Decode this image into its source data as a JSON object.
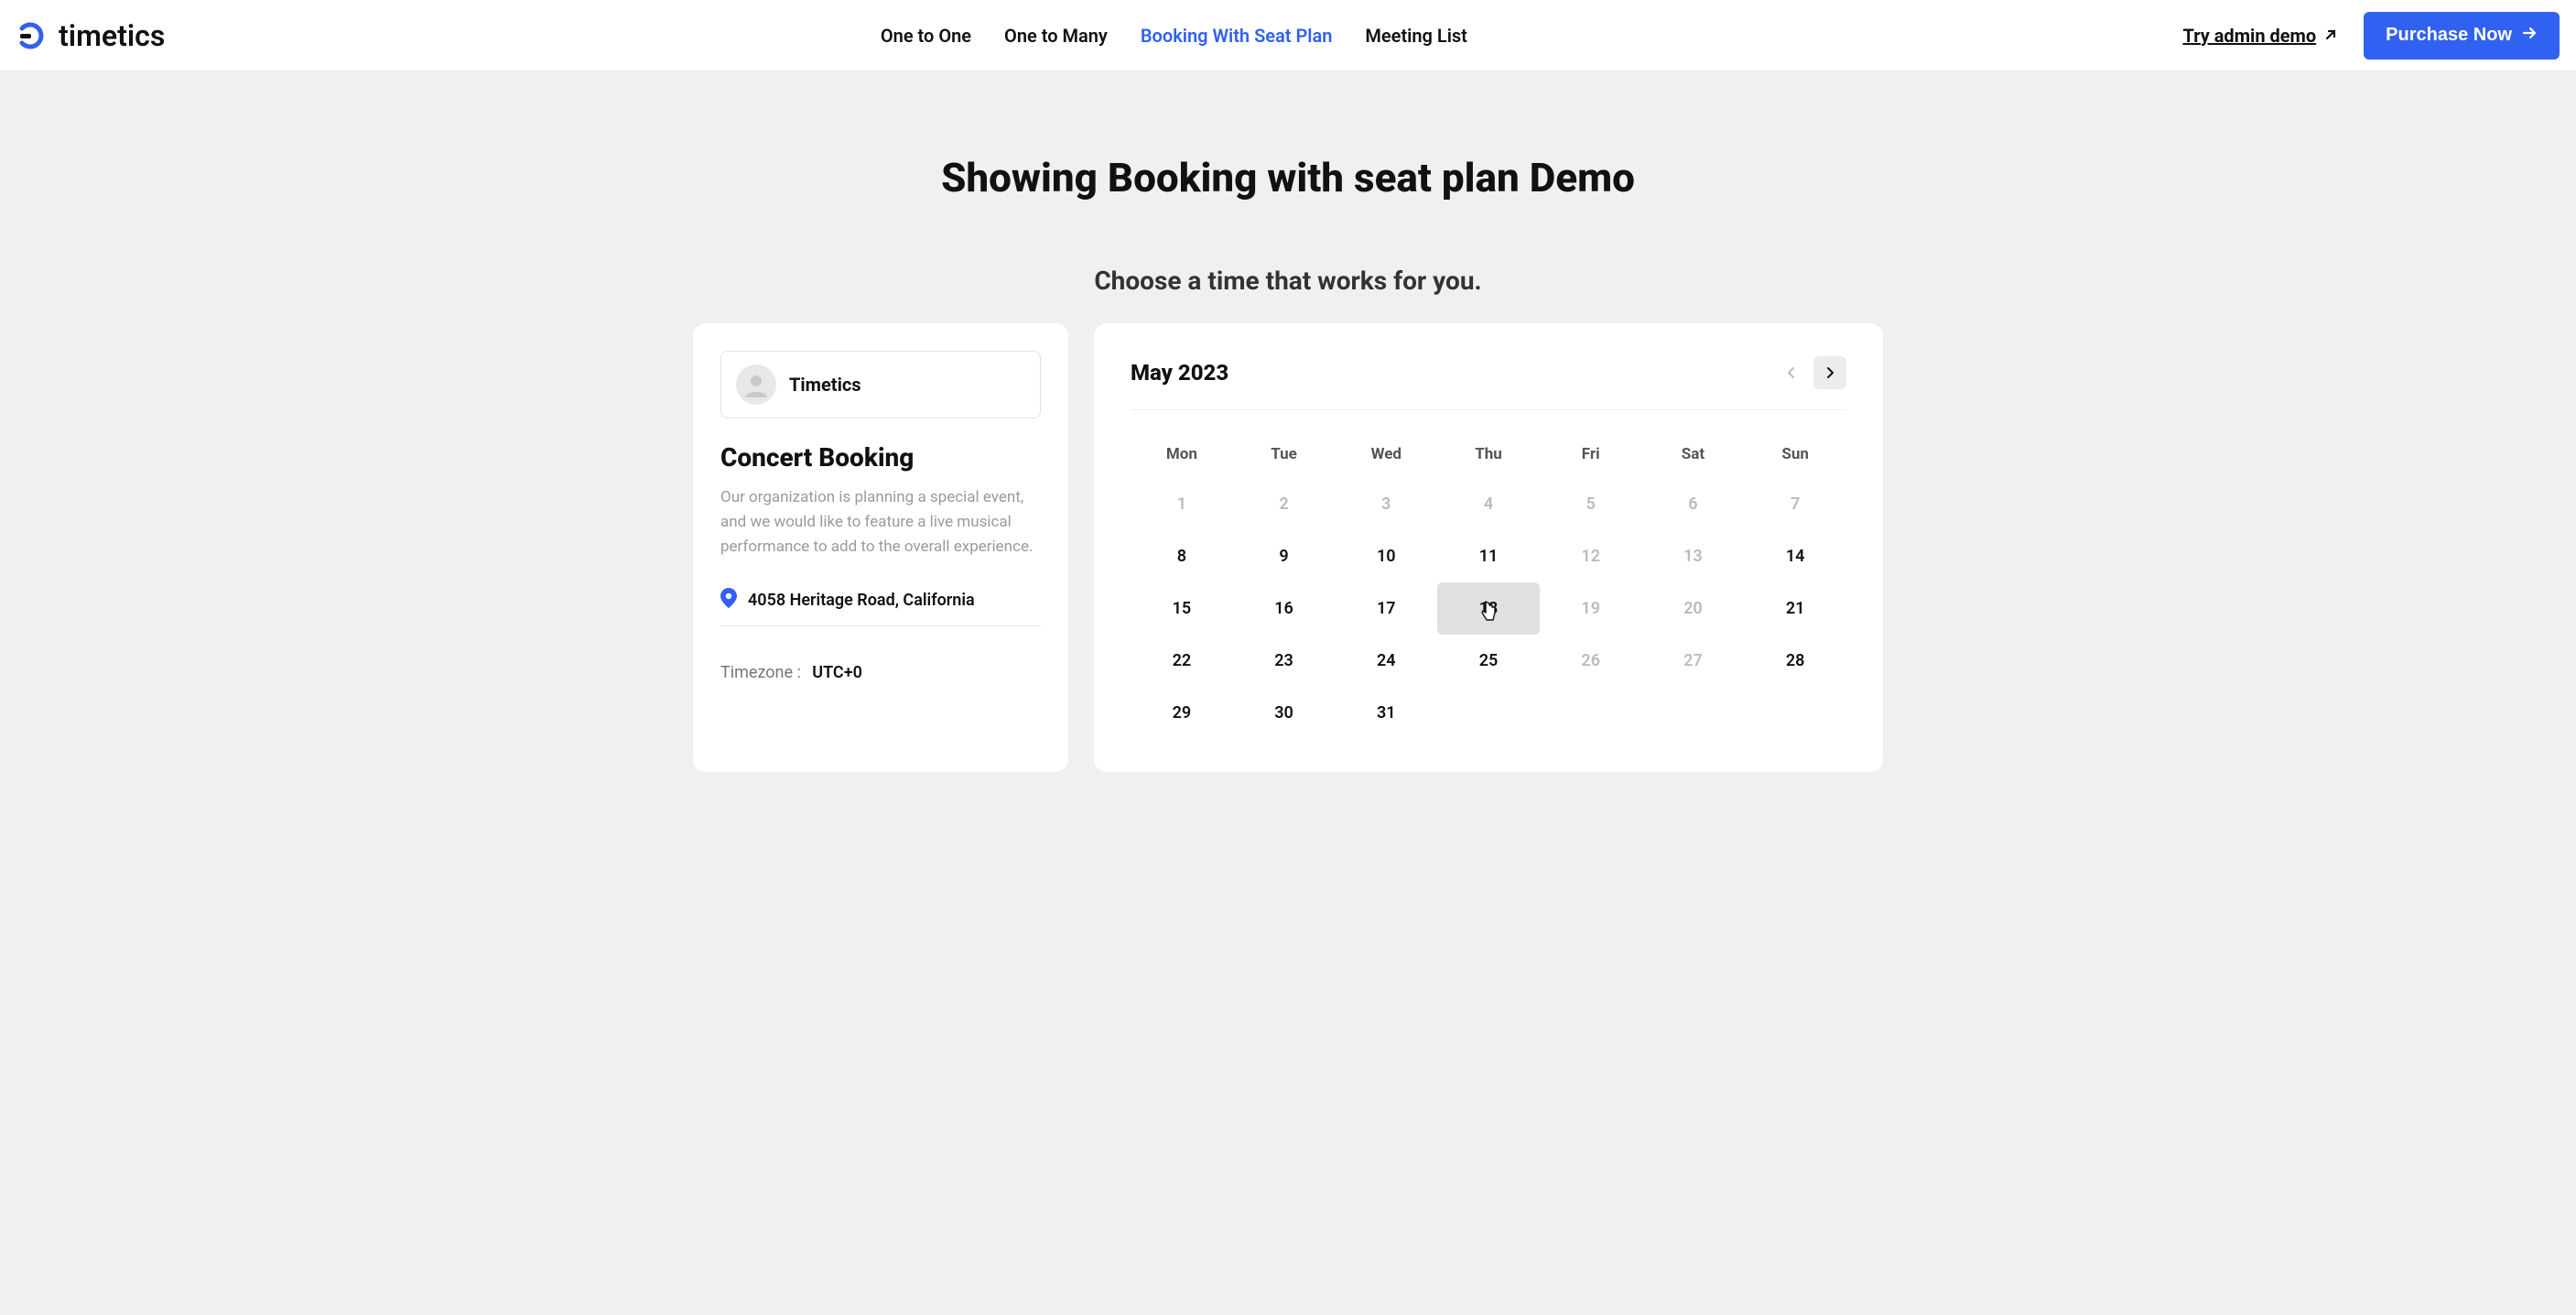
{
  "header": {
    "brand": "timetics",
    "nav": [
      {
        "label": "One to One",
        "active": false
      },
      {
        "label": "One to Many",
        "active": false
      },
      {
        "label": "Booking With Seat Plan",
        "active": true
      },
      {
        "label": "Meeting List",
        "active": false
      }
    ],
    "admin_demo_label": "Try admin demo",
    "purchase_label": "Purchase Now"
  },
  "page": {
    "title": "Showing Booking with seat plan Demo",
    "subtitle": "Choose a time that works for you."
  },
  "event": {
    "org_name": "Timetics",
    "title": "Concert Booking",
    "description": "Our organization is planning a special event, and we would like to feature a live musical performance to add to the overall experience.",
    "location": "4058 Heritage Road, California",
    "timezone_label": "Timezone :",
    "timezone_value": "UTC+0"
  },
  "calendar": {
    "month_label": "May 2023",
    "dow": [
      "Mon",
      "Tue",
      "Wed",
      "Thu",
      "Fri",
      "Sat",
      "Sun"
    ],
    "days": [
      {
        "n": "1",
        "muted": true
      },
      {
        "n": "2",
        "muted": true
      },
      {
        "n": "3",
        "muted": true
      },
      {
        "n": "4",
        "muted": true
      },
      {
        "n": "5",
        "muted": true
      },
      {
        "n": "6",
        "muted": true
      },
      {
        "n": "7",
        "muted": true
      },
      {
        "n": "8"
      },
      {
        "n": "9"
      },
      {
        "n": "10"
      },
      {
        "n": "11"
      },
      {
        "n": "12",
        "muted": true
      },
      {
        "n": "13",
        "muted": true
      },
      {
        "n": "14"
      },
      {
        "n": "15"
      },
      {
        "n": "16"
      },
      {
        "n": "17"
      },
      {
        "n": "18",
        "hovered": true,
        "cursor": true
      },
      {
        "n": "19",
        "muted": true
      },
      {
        "n": "20",
        "muted": true
      },
      {
        "n": "21"
      },
      {
        "n": "22"
      },
      {
        "n": "23"
      },
      {
        "n": "24"
      },
      {
        "n": "25"
      },
      {
        "n": "26",
        "muted": true
      },
      {
        "n": "27",
        "muted": true
      },
      {
        "n": "28"
      },
      {
        "n": "29"
      },
      {
        "n": "30"
      },
      {
        "n": "31"
      }
    ]
  }
}
